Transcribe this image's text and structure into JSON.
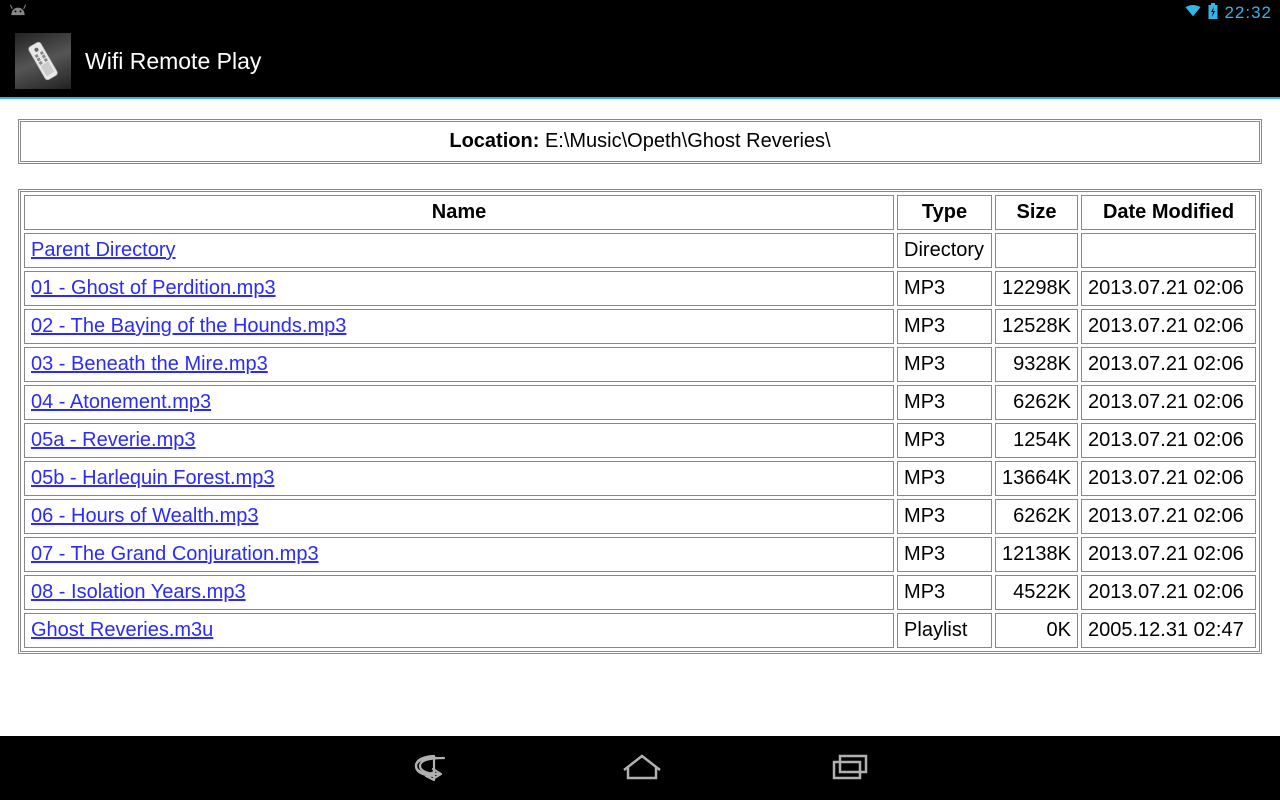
{
  "statusbar": {
    "time": "22:32"
  },
  "app": {
    "title": "Wifi Remote Play"
  },
  "location": {
    "label": "Location:",
    "path": "E:\\Music\\Opeth\\Ghost Reveries\\"
  },
  "table": {
    "headers": {
      "name": "Name",
      "type": "Type",
      "size": "Size",
      "date": "Date Modified"
    },
    "rows": [
      {
        "name": "Parent Directory",
        "type": "Directory",
        "size": "",
        "date": ""
      },
      {
        "name": "01 - Ghost of Perdition.mp3",
        "type": "MP3",
        "size": "12298K",
        "date": "2013.07.21 02:06"
      },
      {
        "name": "02 - The Baying of the Hounds.mp3",
        "type": "MP3",
        "size": "12528K",
        "date": "2013.07.21 02:06"
      },
      {
        "name": "03 - Beneath the Mire.mp3",
        "type": "MP3",
        "size": "9328K",
        "date": "2013.07.21 02:06"
      },
      {
        "name": "04 - Atonement.mp3",
        "type": "MP3",
        "size": "6262K",
        "date": "2013.07.21 02:06"
      },
      {
        "name": "05a - Reverie.mp3",
        "type": "MP3",
        "size": "1254K",
        "date": "2013.07.21 02:06"
      },
      {
        "name": "05b - Harlequin Forest.mp3",
        "type": "MP3",
        "size": "13664K",
        "date": "2013.07.21 02:06"
      },
      {
        "name": "06 - Hours of Wealth.mp3",
        "type": "MP3",
        "size": "6262K",
        "date": "2013.07.21 02:06"
      },
      {
        "name": "07 - The Grand Conjuration.mp3",
        "type": "MP3",
        "size": "12138K",
        "date": "2013.07.21 02:06"
      },
      {
        "name": "08 - Isolation Years.mp3",
        "type": "MP3",
        "size": "4522K",
        "date": "2013.07.21 02:06"
      },
      {
        "name": "Ghost Reveries.m3u",
        "type": "Playlist",
        "size": "0K",
        "date": "2005.12.31 02:47"
      }
    ]
  }
}
